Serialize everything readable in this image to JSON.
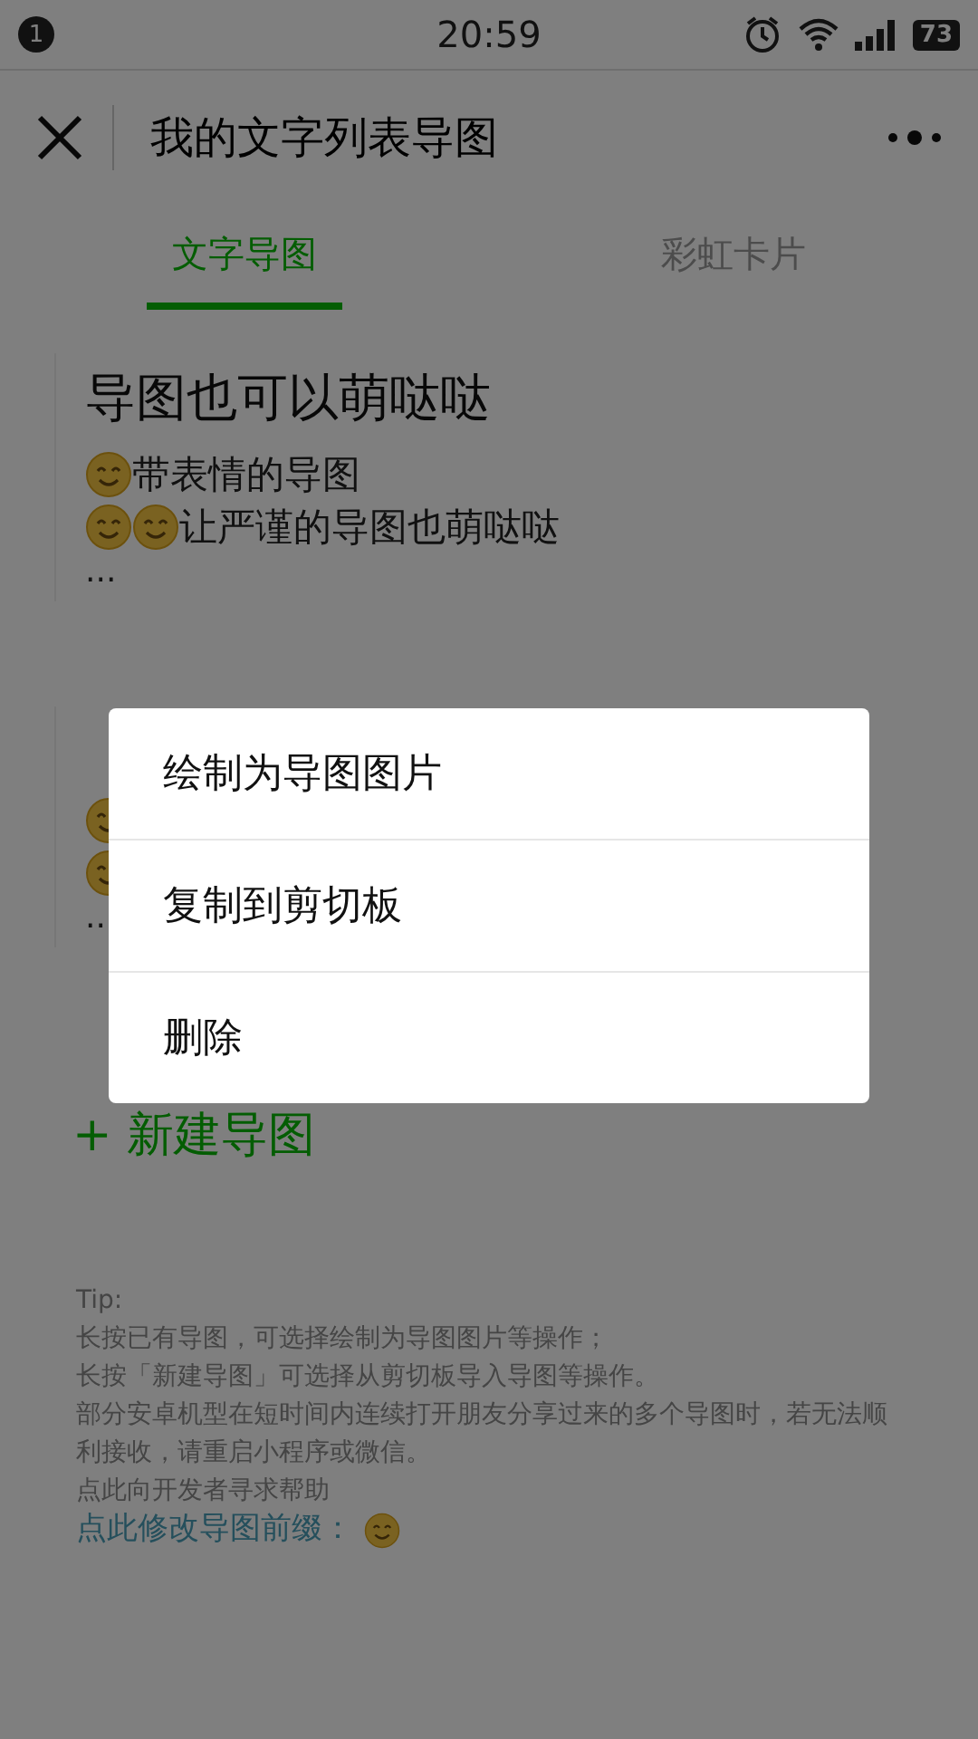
{
  "status_bar": {
    "notification_count": "1",
    "time": "20:59",
    "battery": "73"
  },
  "nav": {
    "title": "我的文字列表导图"
  },
  "tabs": [
    {
      "label": "文字导图",
      "selected": true
    },
    {
      "label": "彩虹卡片",
      "selected": false
    }
  ],
  "maps": [
    {
      "title": "导图也可以萌哒哒",
      "lines": [
        {
          "icons": [
            {
              "kind": "smile"
            }
          ],
          "text": "带表情的导图"
        },
        {
          "icons": [
            {
              "kind": "smile"
            },
            {
              "kind": "smile"
            }
          ],
          "text": "让严谨的导图也萌哒哒"
        }
      ],
      "more": "..."
    },
    {
      "lines": [
        {
          "icons": [
            {
              "kind": "smile"
            }
          ]
        },
        {
          "icons": [
            {
              "kind": "smile"
            }
          ]
        }
      ],
      "more": ".."
    }
  ],
  "new_button": {
    "icon": "+",
    "label": "新建导图"
  },
  "tips": {
    "heading": "Tip:",
    "lines": [
      "长按已有导图，可选择绘制为导图图片等操作；",
      "长按「新建导图」可选择从剪切板导入导图等操作。",
      "部分安卓机型在短时间内连续打开朋友分享过来的多个导图时，若无法顺利接收，请重启小程序或微信。",
      "点此向开发者寻求帮助"
    ],
    "prefix_link": "点此修改导图前缀："
  },
  "menu": {
    "items": [
      "绘制为导图图片",
      "复制到剪切板",
      "删除"
    ]
  }
}
